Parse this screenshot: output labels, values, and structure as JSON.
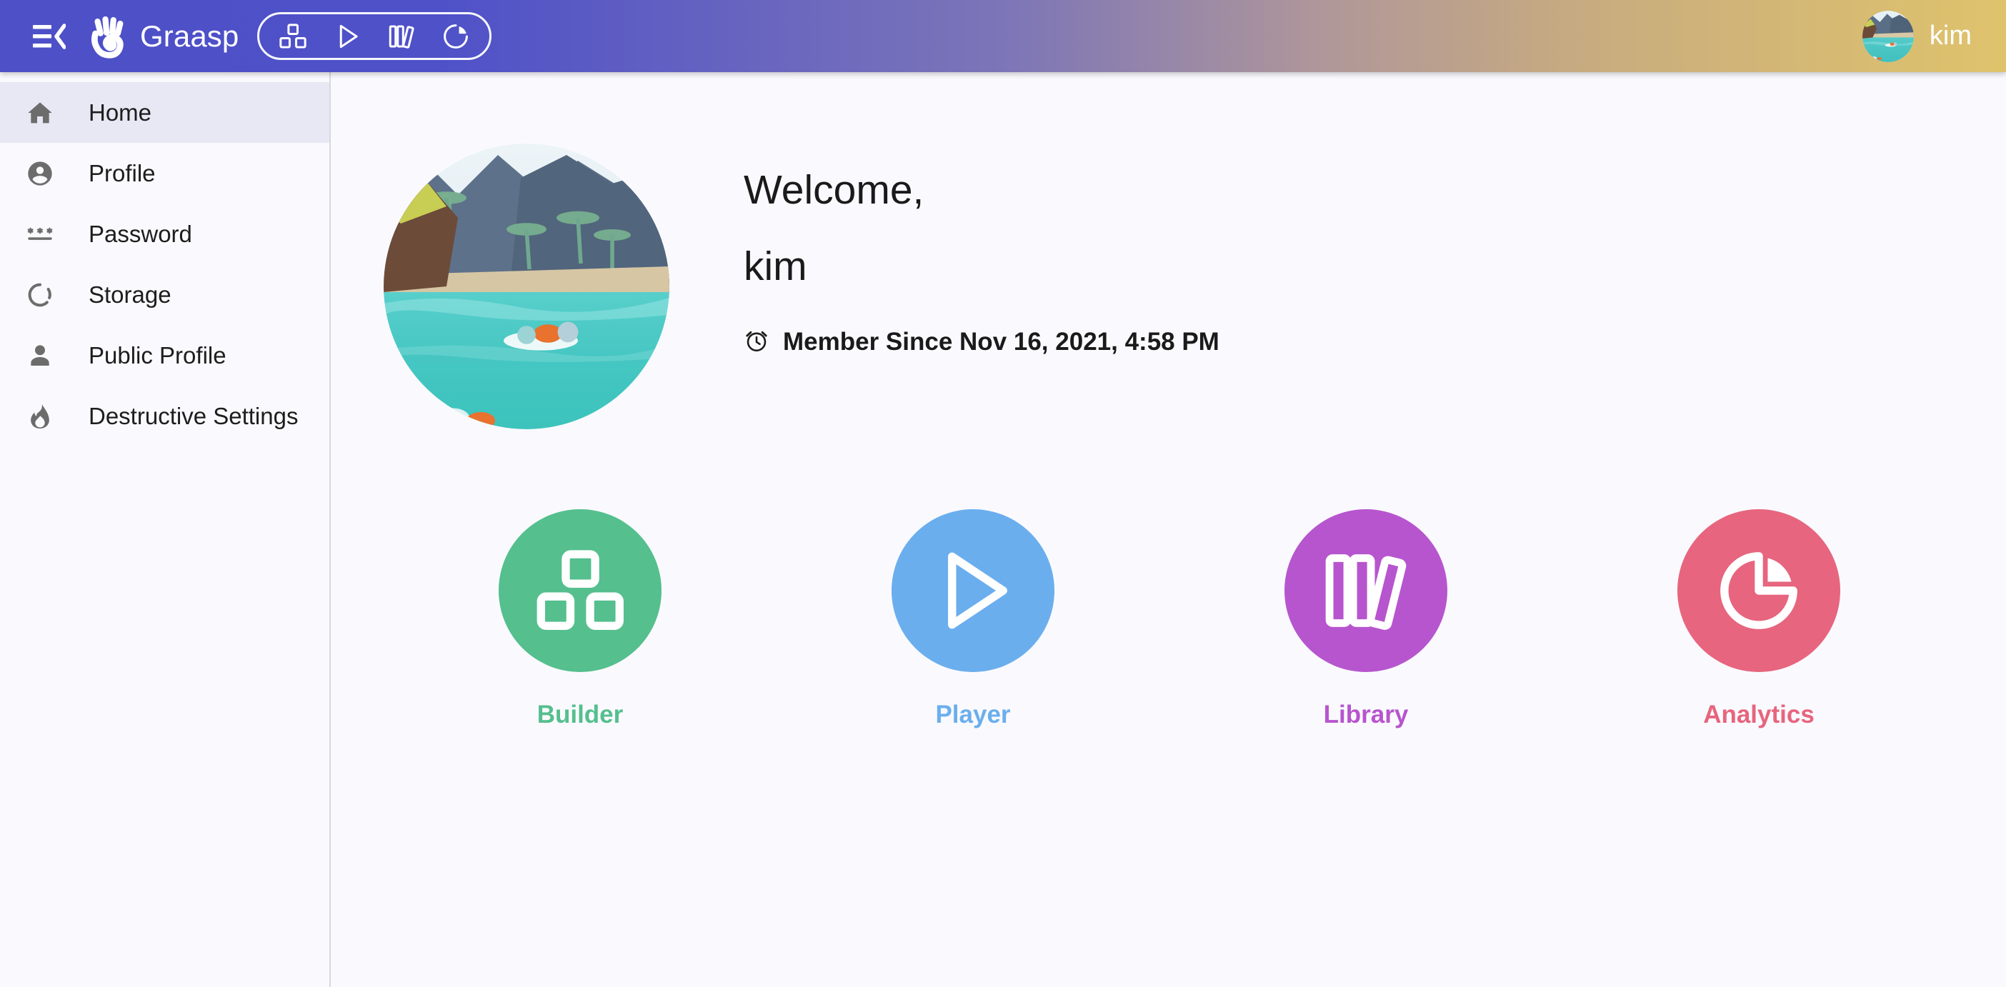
{
  "header": {
    "menu_icon": "menu-collapse-icon",
    "brand_name": "Graasp",
    "brand_logo_icon": "graasp-hand-logo",
    "app_switcher": [
      {
        "name": "builder",
        "icon": "builder-blocks-icon"
      },
      {
        "name": "player",
        "icon": "play-triangle-icon"
      },
      {
        "name": "library",
        "icon": "books-icon"
      },
      {
        "name": "analytics",
        "icon": "pie-chart-icon"
      }
    ],
    "username": "kim",
    "avatar_icon": "user-avatar-beach-image",
    "gradient_start": "#4E50C8",
    "gradient_end": "#DFC36C"
  },
  "sidebar": {
    "items": [
      {
        "label": "Home",
        "icon": "home-icon",
        "selected": true
      },
      {
        "label": "Profile",
        "icon": "account-circle-icon",
        "selected": false
      },
      {
        "label": "Password",
        "icon": "password-asterisks-icon",
        "selected": false
      },
      {
        "label": "Storage",
        "icon": "storage-donut-icon",
        "selected": false
      },
      {
        "label": "Public Profile",
        "icon": "person-icon",
        "selected": false
      },
      {
        "label": "Destructive Settings",
        "icon": "flame-icon",
        "selected": false
      }
    ],
    "selected_bg": "#E8E8F4"
  },
  "main": {
    "avatar_icon": "profile-avatar-beach-image",
    "greeting": "Welcome,",
    "name": "kim",
    "member_since_icon": "alarm-clock-icon",
    "member_since": "Member Since Nov 16, 2021, 4:58 PM",
    "tiles": [
      {
        "label": "Builder",
        "icon": "builder-blocks-icon",
        "color": "#55BF8E"
      },
      {
        "label": "Player",
        "icon": "play-triangle-icon",
        "color": "#6BAEEE"
      },
      {
        "label": "Library",
        "icon": "books-icon",
        "color": "#B755CE"
      },
      {
        "label": "Analytics",
        "icon": "pie-chart-icon",
        "color": "#E7657E"
      }
    ]
  }
}
